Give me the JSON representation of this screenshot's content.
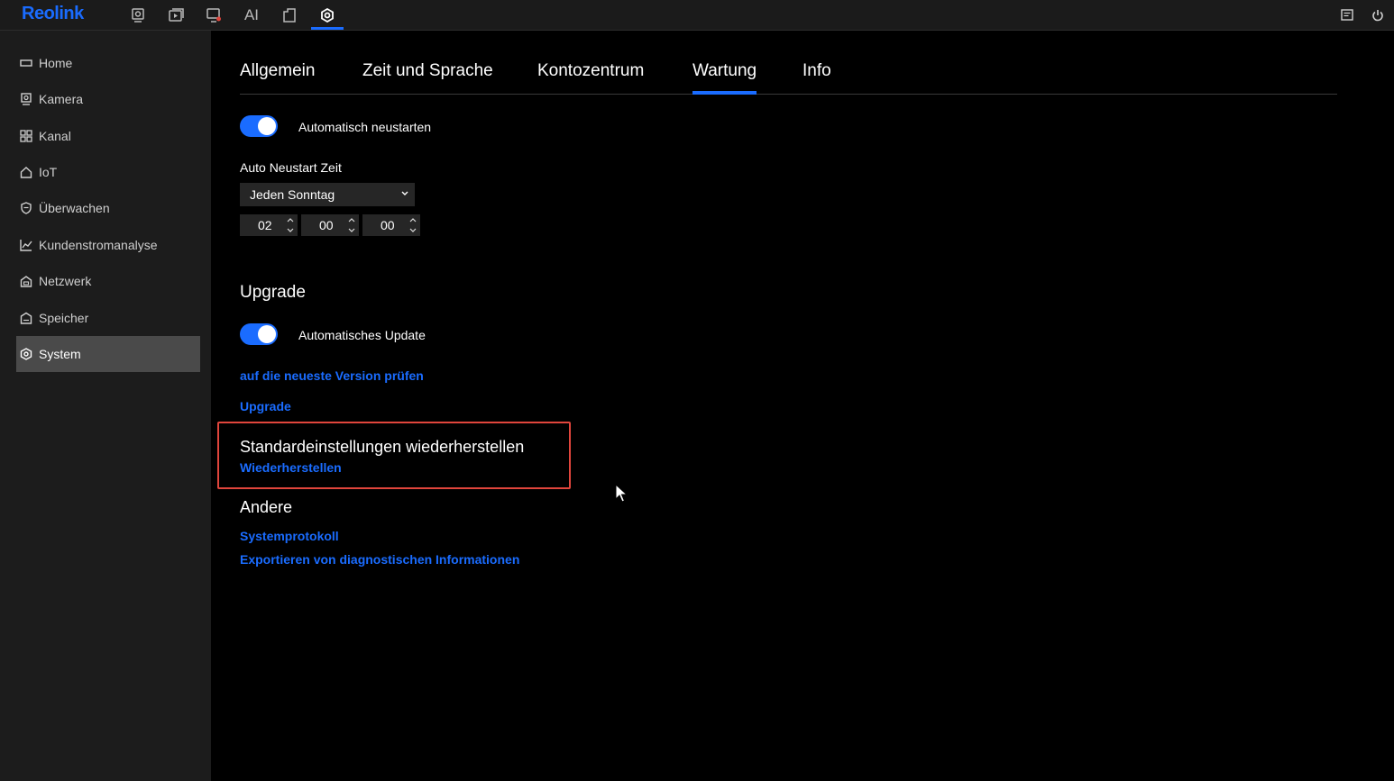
{
  "app": {
    "logo": "Reolink"
  },
  "topnav": {
    "items": [
      {
        "name": "camera-icon"
      },
      {
        "name": "playback-icon"
      },
      {
        "name": "alarm-icon"
      },
      {
        "name": "ai-label",
        "label": "AI"
      },
      {
        "name": "file-icon"
      },
      {
        "name": "settings-icon",
        "active": true
      }
    ],
    "right": [
      {
        "name": "message-icon"
      },
      {
        "name": "power-icon"
      }
    ]
  },
  "sidebar": {
    "items": [
      {
        "label": "Home",
        "icon": "home-icon"
      },
      {
        "label": "Kamera",
        "icon": "camera-icon"
      },
      {
        "label": "Kanal",
        "icon": "channel-grid-icon"
      },
      {
        "label": "IoT",
        "icon": "iot-home-icon"
      },
      {
        "label": "Überwachen",
        "icon": "shield-icon"
      },
      {
        "label": "Kundenstromanalyse",
        "icon": "chart-icon"
      },
      {
        "label": "Netzwerk",
        "icon": "network-icon"
      },
      {
        "label": "Speicher",
        "icon": "storage-icon"
      },
      {
        "label": "System",
        "icon": "gear-icon",
        "active": true
      }
    ]
  },
  "tabs": [
    {
      "label": "Allgemein"
    },
    {
      "label": "Zeit und Sprache"
    },
    {
      "label": "Kontozentrum"
    },
    {
      "label": "Wartung",
      "active": true
    },
    {
      "label": "Info"
    }
  ],
  "maintenance": {
    "auto_restart_label": "Automatisch neustarten",
    "auto_restart_on": true,
    "restart_time_label": "Auto Neustart Zeit",
    "restart_day": "Jeden Sonntag",
    "restart_hour": "02",
    "restart_minute": "00",
    "restart_second": "00"
  },
  "upgrade": {
    "title": "Upgrade",
    "auto_update_label": "Automatisches Update",
    "auto_update_on": true,
    "check_link": "auf die neueste Version prüfen",
    "upgrade_link": "Upgrade"
  },
  "restore": {
    "title": "Standardeinstellungen wiederherstellen",
    "restore_link": "Wiederherstellen"
  },
  "other": {
    "title": "Andere",
    "system_log_link": "Systemprotokoll",
    "export_link": "Exportieren von diagnostischen Informationen"
  },
  "colors": {
    "accent": "#1a6cff",
    "highlight": "#e0453c",
    "sidebar": "#1c1c1c",
    "background": "#000000"
  }
}
